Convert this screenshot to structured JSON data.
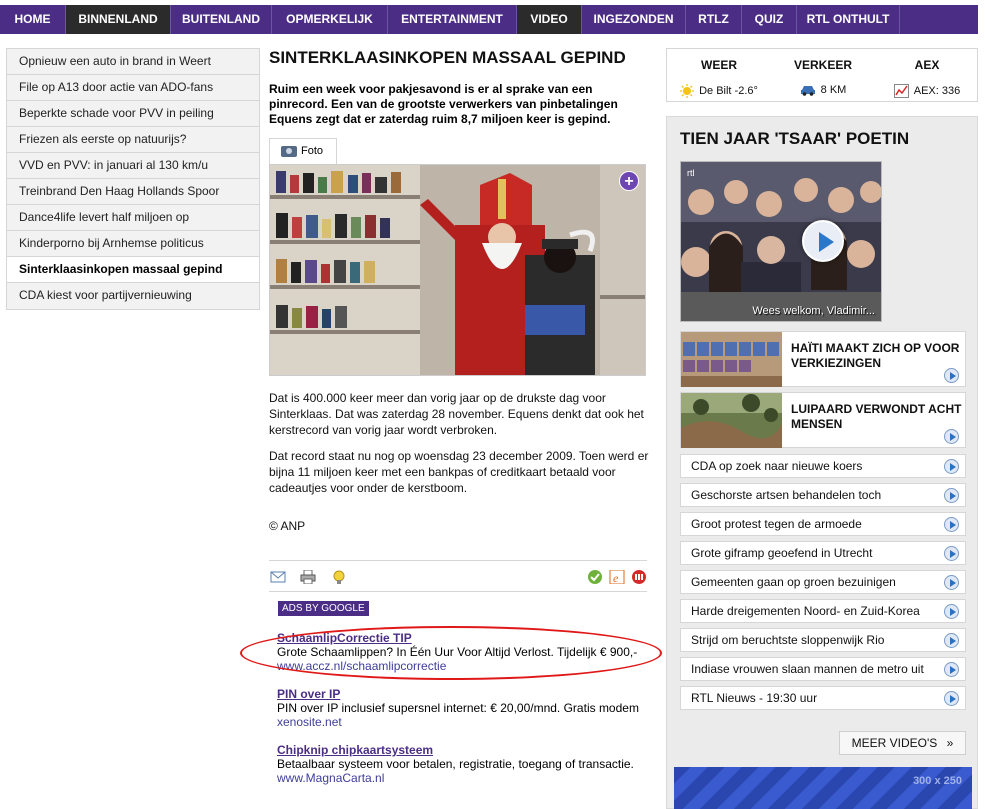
{
  "nav": {
    "items": [
      {
        "label": "HOME"
      },
      {
        "label": "BINNENLAND"
      },
      {
        "label": "BUITENLAND"
      },
      {
        "label": "OPMERKELIJK"
      },
      {
        "label": "ENTERTAINMENT"
      },
      {
        "label": "VIDEO"
      },
      {
        "label": "INGEZONDEN"
      },
      {
        "label": "RTLZ"
      },
      {
        "label": "QUIZ"
      },
      {
        "label": "RTL ONTHULT"
      }
    ],
    "active": [
      "BINNENLAND",
      "VIDEO"
    ]
  },
  "sidebar": {
    "items": [
      {
        "label": "Opnieuw een auto in brand in Weert"
      },
      {
        "label": "File op A13 door actie van ADO-fans"
      },
      {
        "label": "Beperkte schade voor PVV in peiling"
      },
      {
        "label": "Friezen als eerste op natuurijs?"
      },
      {
        "label": "VVD en PVV: in januari al 130 km/u"
      },
      {
        "label": "Treinbrand Den Haag Hollands Spoor"
      },
      {
        "label": "Dance4life levert half miljoen op"
      },
      {
        "label": "Kinderporno bij Arnhemse politicus"
      },
      {
        "label": "Sinterklaasinkopen massaal gepind"
      },
      {
        "label": "CDA kiest voor partijvernieuwing"
      }
    ],
    "active": "Sinterklaasinkopen massaal gepind"
  },
  "article": {
    "title": "SINTERKLAASINKOPEN MASSAAL GEPIND",
    "lead": "Ruim een week voor pakjesavond is er al sprake van een pinrecord. Een van de grootste verwerkers van pinbetalingen Equens zegt dat er zaterdag ruim 8,7 miljoen keer is gepind.",
    "photo_tab": "Foto",
    "photo_plus": "+",
    "paragraphs": [
      "Dat is 400.000 keer meer dan vorig jaar op de drukste dag voor Sinterklaas. Dat was zaterdag 28 november. Equens denkt dat ook het kerstrecord van vorig jaar wordt verbroken.",
      "Dat record staat nu nog op woensdag 23 december 2009. Toen werd er bijna 11 miljoen keer met een bankpas of creditkaart betaald voor cadeautjes voor onder de kerstboom."
    ],
    "credit": "© ANP",
    "tools": [
      "mail-icon",
      "print-icon",
      "tip-icon",
      "check-icon",
      "bookmark-icon",
      "share-icon"
    ]
  },
  "ads": {
    "label": "ADS BY GOOGLE",
    "items": [
      {
        "title": "SchaamlipCorrectie TIP",
        "desc": "Grote Schaamlippen? In Één Uur Voor Altijd Verlost. Tijdelijk € 900,-",
        "url": "www.accz.nl/schaamlipcorrectie"
      },
      {
        "title": "PIN over IP",
        "desc": "PIN over IP inclusief supersnel internet: € 20,00/mnd. Gratis modem",
        "url": "xenosite.net"
      },
      {
        "title": "Chipknip chipkaartsysteem",
        "desc": "Betaalbaar systeem voor betalen, registratie, toegang of transactie.",
        "url": "www.MagnaCarta.nl"
      }
    ]
  },
  "info": {
    "weer": {
      "head": "WEER",
      "value": "De Bilt -2.6°"
    },
    "verkeer": {
      "head": "VERKEER",
      "value": "8 KM"
    },
    "aex": {
      "head": "AEX",
      "value": "AEX: 336"
    }
  },
  "video": {
    "title": "TIEN JAAR 'TSAAR' POETIN",
    "main_caption": "Wees welkom, Vladimir...",
    "logo": "rtl",
    "featured": [
      {
        "title": "HAÏTI MAAKT ZICH OP VOOR VERKIEZINGEN"
      },
      {
        "title": "LUIPAARD VERWONDT ACHT MENSEN"
      }
    ],
    "list": [
      {
        "label": "CDA op zoek naar nieuwe koers"
      },
      {
        "label": "Geschorste artsen behandelen toch"
      },
      {
        "label": "Groot protest tegen de armoede"
      },
      {
        "label": "Grote giframp geoefend in Utrecht"
      },
      {
        "label": "Gemeenten gaan op groen bezuinigen"
      },
      {
        "label": "Harde dreigementen Noord- en Zuid-Korea"
      },
      {
        "label": "Strijd om beruchtste sloppenwijk Rio"
      },
      {
        "label": "Indiase vrouwen slaan mannen de metro uit"
      },
      {
        "label": "RTL Nieuws - 19:30 uur"
      }
    ],
    "more": "MEER VIDEO'S",
    "more_arrow": "»",
    "banner": "300 x 250"
  }
}
